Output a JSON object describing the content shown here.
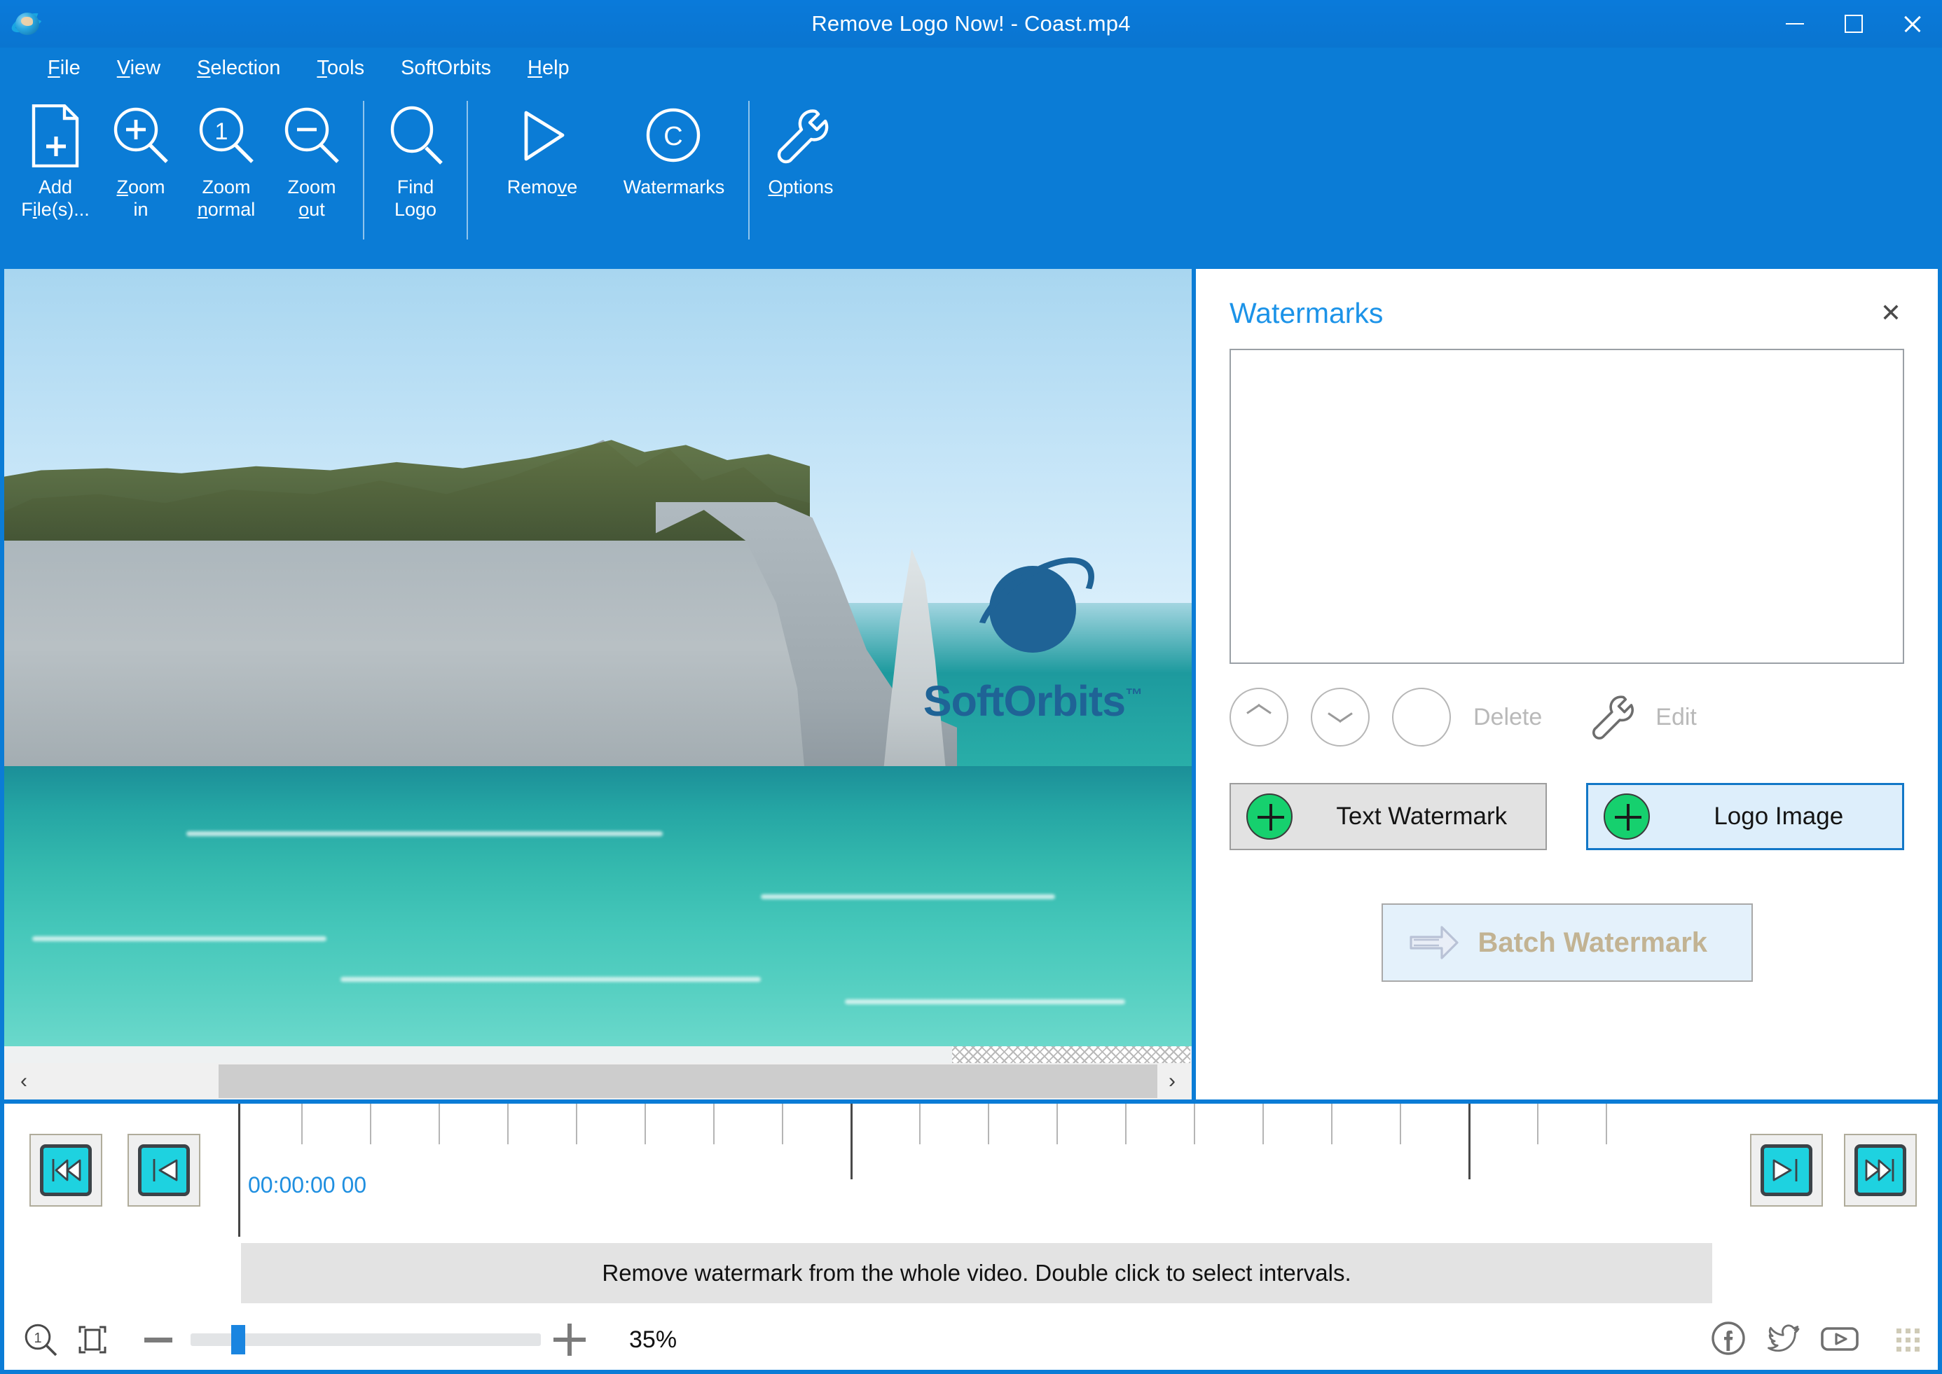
{
  "window": {
    "title": "Remove Logo Now! - Coast.mp4",
    "app_icon": "softorbits-planet-icon",
    "minimize_label": "—",
    "maximize_label": "□",
    "close_label": "✕"
  },
  "menubar": {
    "items": [
      {
        "label": "File",
        "accel": "F"
      },
      {
        "label": "View",
        "accel": "V"
      },
      {
        "label": "Selection",
        "accel": "S"
      },
      {
        "label": "Tools",
        "accel": "T"
      },
      {
        "label": "SoftOrbits",
        "accel": ""
      },
      {
        "label": "Help",
        "accel": "H"
      }
    ]
  },
  "toolbar": {
    "items": [
      {
        "label": "Add\nFile(s)...",
        "icon": "add-file-icon"
      },
      {
        "label": "Zoom\nin",
        "icon": "zoom-in-icon"
      },
      {
        "label": "Zoom\nnormal",
        "icon": "zoom-normal-icon"
      },
      {
        "label": "Zoom\nout",
        "icon": "zoom-out-icon"
      },
      {
        "label": "Find\nLogo",
        "icon": "find-logo-icon"
      },
      {
        "label": "Remove",
        "icon": "play-triangle-icon"
      },
      {
        "label": "Watermarks",
        "icon": "copyright-circle-icon"
      },
      {
        "label": "Options",
        "icon": "wrench-icon"
      }
    ]
  },
  "canvas": {
    "watermark_text": "SoftOrbits",
    "watermark_tm": "™",
    "scrollbar_left": "‹",
    "scrollbar_right": "›"
  },
  "panel": {
    "title": "Watermarks",
    "close": "✕",
    "list_items": [],
    "tools": {
      "move_up": "move-up",
      "move_down": "move-down",
      "delete_label": "Delete",
      "edit_label": "Edit"
    },
    "add_buttons": [
      {
        "label": "Text Watermark",
        "style": "grey"
      },
      {
        "label": "Logo Image",
        "style": "blue"
      }
    ],
    "batch_label": "Batch Watermark"
  },
  "timeline": {
    "timecode": "00:00:00 00",
    "buttons_left": [
      {
        "name": "skip-to-start",
        "glyph": "rewind-start"
      },
      {
        "name": "previous-frame",
        "glyph": "step-back"
      }
    ],
    "buttons_right": [
      {
        "name": "next-frame",
        "glyph": "step-forward"
      },
      {
        "name": "skip-to-end",
        "glyph": "fast-forward-end"
      }
    ]
  },
  "status": {
    "message": "Remove watermark from the whole video. Double click to select intervals."
  },
  "bottombar": {
    "zoom_value": "35%",
    "zoom_one_to_one_icon": "zoom-actual-size-icon",
    "fit_icon": "fit-to-window-icon",
    "minus_icon": "zoom-out-icon",
    "plus_icon": "zoom-in-icon",
    "social": [
      {
        "name": "facebook-icon",
        "label": "f"
      },
      {
        "name": "twitter-icon",
        "label": "t"
      },
      {
        "name": "youtube-icon",
        "label": "y"
      }
    ]
  },
  "colors": {
    "titlebar_blue": "#0b7cd6",
    "accent_blue": "#1c93e8",
    "green_plus": "#16d06e",
    "cyan_button": "#1ed2e0",
    "batch_text": "#c2b393",
    "timecode_blue": "#1f8fe0"
  }
}
